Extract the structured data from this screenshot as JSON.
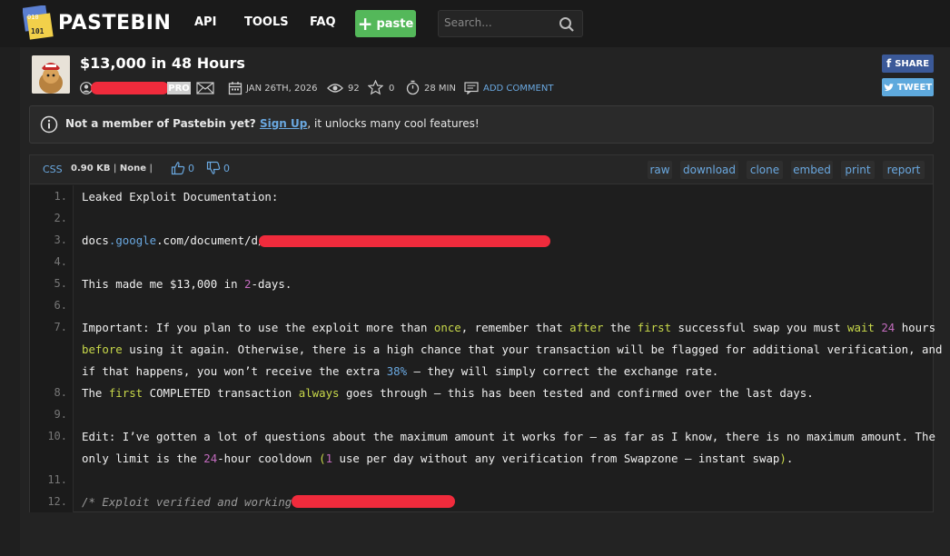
{
  "header": {
    "brand": "PASTEBIN",
    "nav": [
      "API",
      "TOOLS",
      "FAQ"
    ],
    "paste_label": "paste",
    "search_placeholder": "Search..."
  },
  "paste": {
    "title": "$13,000 in 48 Hours",
    "pro_badge": "PRO",
    "date": "JAN 26TH, 2026",
    "views": "92",
    "stars": "0",
    "expire": "28 MIN",
    "add_comment": "ADD COMMENT"
  },
  "social": {
    "share": "SHARE",
    "tweet": "TWEET"
  },
  "notice": {
    "lead": "Not a member of Pastebin yet?",
    "signup": "Sign Up",
    "rest": ", it unlocks many cool features!"
  },
  "codebar": {
    "lang": "CSS",
    "size": "0.90 KB",
    "sep1": "|",
    "visibility": "None",
    "sep2": "|",
    "likes": "0",
    "dislikes": "0",
    "actions": [
      "raw",
      "download",
      "clone",
      "embed",
      "print",
      "report"
    ]
  },
  "code": {
    "line_numbers": [
      "1.",
      "2.",
      "3.",
      "4.",
      "5.",
      "6.",
      "7.",
      "8.",
      "9.",
      "10.",
      "11.",
      "12."
    ],
    "l1": "Leaked Exploit Documentation:",
    "l3a": "docs",
    "l3b": ".",
    "l3c": "google",
    "l3d": ".com/document/d/",
    "l5a": "This made me $13,000 in ",
    "l5b": "2",
    "l5c": "-days.",
    "l7_1": [
      "Important: If you plan to use the exploit more than ",
      "once",
      ", remember that ",
      "after",
      " the ",
      "first",
      " successful swap you must ",
      "wait",
      " ",
      "24",
      " hours"
    ],
    "l7_2": [
      "before",
      " using it again. Otherwise, there is a high chance that your transaction will be flagged for additional verification, and"
    ],
    "l7_3": [
      "if that happens, you won’t receive the extra ",
      "38%",
      " — they will simply correct the exchange rate."
    ],
    "l8": [
      "The ",
      "first",
      " COMPLETED transaction ",
      "always",
      " goes through — this has been tested and confirmed over the last days."
    ],
    "l10_1": "Edit: I’ve gotten a lot of questions about the maximum amount it works for — as far as I know, there is no maximum amount. The",
    "l10_2": [
      "only limit is the ",
      "24",
      "-hour cooldown ",
      "(",
      "1",
      " use per day without any verification from Swapzone — instant swap",
      ")",
      "."
    ],
    "l12": "/* Exploit verified and working "
  },
  "colors": {
    "accent": "#6aa8e0",
    "paste_button": "#54b85a",
    "redaction": "#f02b3c",
    "keyword": "#c8d84a",
    "number": "#c26bbd"
  }
}
